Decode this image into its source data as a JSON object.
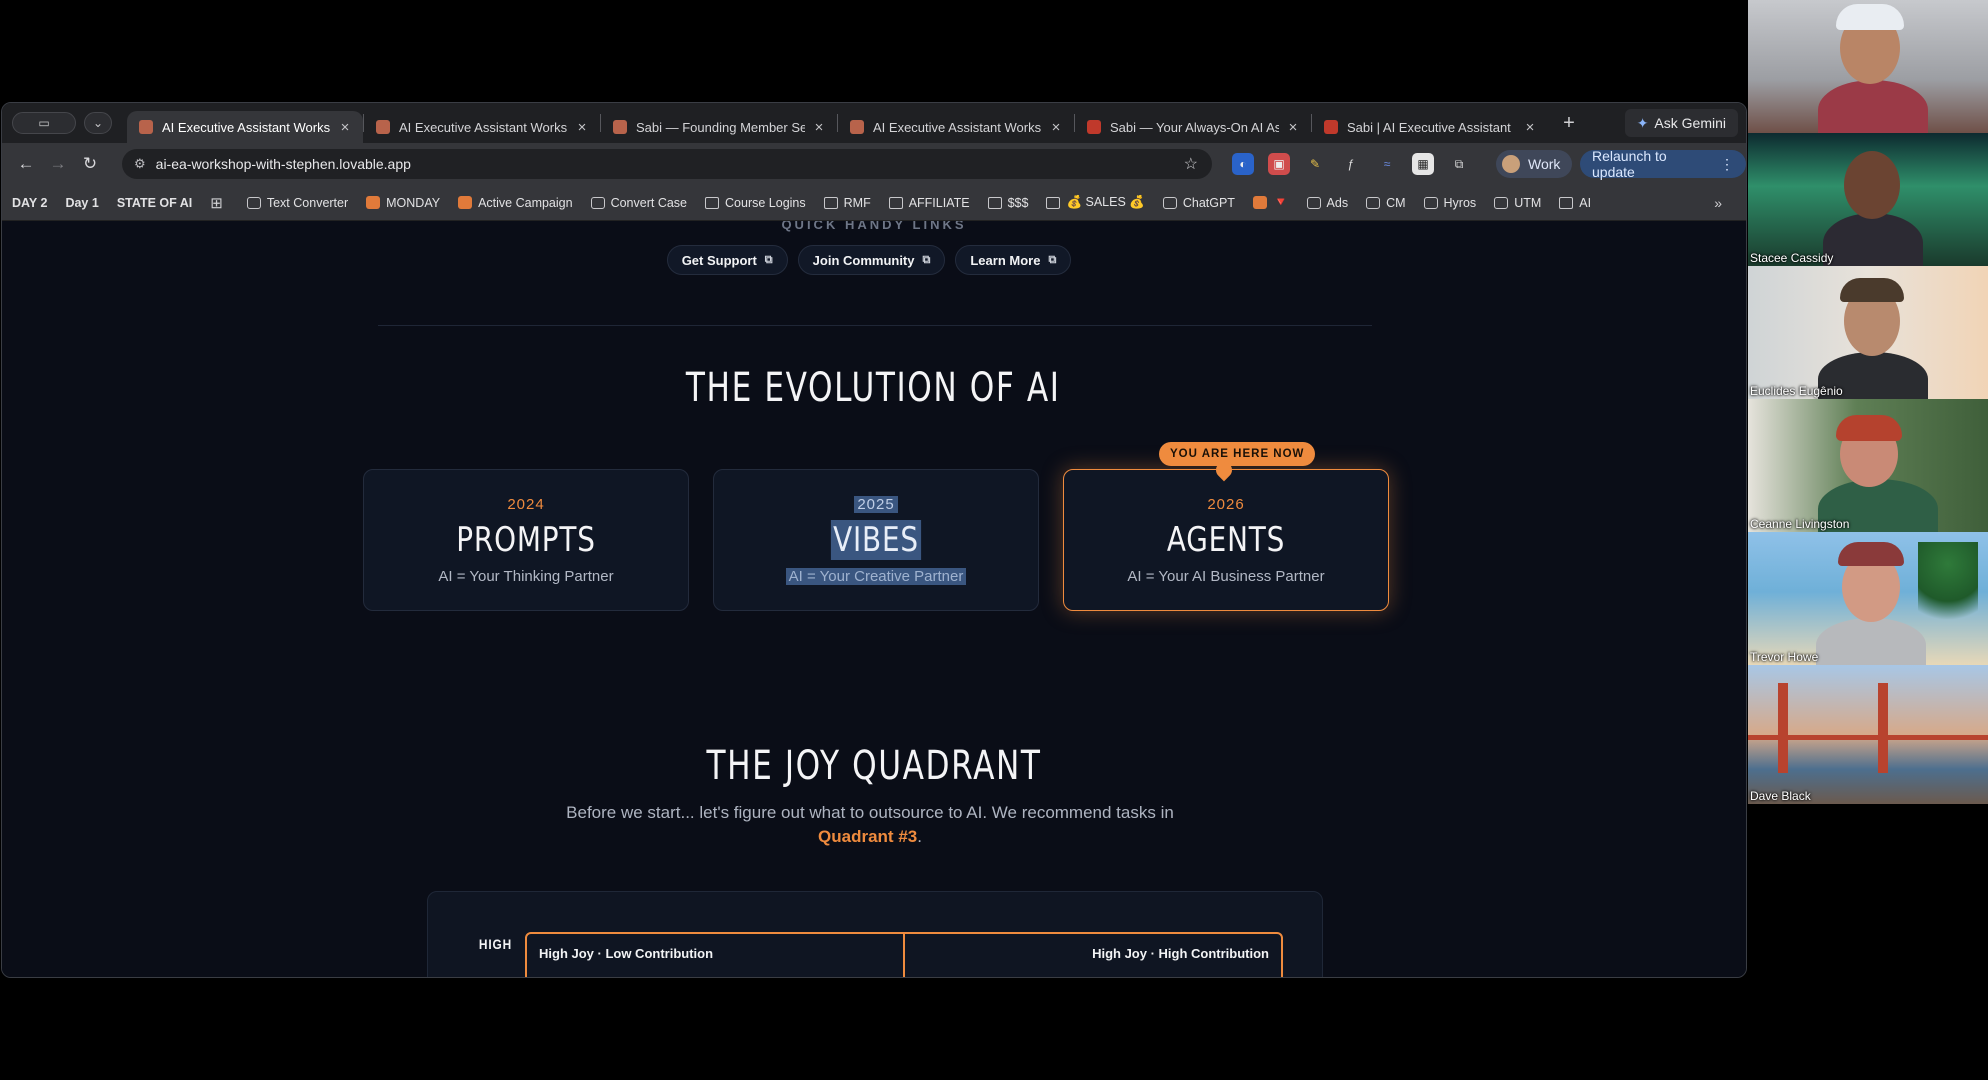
{
  "browser": {
    "tabs": [
      {
        "title": "AI Executive Assistant Works",
        "active": true,
        "fav": "#b8634b"
      },
      {
        "title": "AI Executive Assistant Works",
        "active": false,
        "fav": "#b8634b"
      },
      {
        "title": "Sabi — Founding Member Se",
        "active": false,
        "fav": "#b8634b"
      },
      {
        "title": "AI Executive Assistant Works",
        "active": false,
        "fav": "#b8634b"
      },
      {
        "title": "Sabi — Your Always-On AI As",
        "active": false,
        "fav": "#c0392b"
      },
      {
        "title": "Sabi | AI Executive Assistant",
        "active": false,
        "fav": "#c0392b"
      }
    ],
    "ask_gemini": "Ask Gemini",
    "url": "ai-ea-workshop-with-stephen.lovable.app",
    "profile": "Work",
    "relaunch": "Relaunch to update",
    "bookmarks": [
      {
        "label": "DAY 2",
        "bold": true,
        "icon": "none"
      },
      {
        "label": "Day 1",
        "bold": true,
        "icon": "none"
      },
      {
        "label": "STATE OF AI",
        "bold": true,
        "icon": "none"
      },
      {
        "label": "",
        "bold": false,
        "icon": "apps"
      },
      {
        "label": "Text Converter",
        "bold": false,
        "icon": "page"
      },
      {
        "label": "MONDAY",
        "bold": false,
        "icon": "solid"
      },
      {
        "label": "Active Campaign",
        "bold": false,
        "icon": "solid"
      },
      {
        "label": "Convert Case",
        "bold": false,
        "icon": "page"
      },
      {
        "label": "Course Logins",
        "bold": false,
        "icon": "folder"
      },
      {
        "label": "RMF",
        "bold": false,
        "icon": "folder"
      },
      {
        "label": "AFFILIATE",
        "bold": false,
        "icon": "folder"
      },
      {
        "label": "$$$",
        "bold": false,
        "icon": "folder"
      },
      {
        "label": "💰 SALES 💰",
        "bold": false,
        "icon": "folder"
      },
      {
        "label": "ChatGPT",
        "bold": false,
        "icon": "page"
      },
      {
        "label": "🔻",
        "bold": false,
        "icon": "solid"
      },
      {
        "label": "Ads",
        "bold": false,
        "icon": "page"
      },
      {
        "label": "CM",
        "bold": false,
        "icon": "page"
      },
      {
        "label": "Hyros",
        "bold": false,
        "icon": "page"
      },
      {
        "label": "UTM",
        "bold": false,
        "icon": "page"
      },
      {
        "label": "AI",
        "bold": false,
        "icon": "folder"
      }
    ]
  },
  "page": {
    "quick_links_title": "QUICK HANDY LINKS",
    "quick_links": [
      "Get Support",
      "Join Community",
      "Learn More"
    ],
    "evolution_title": "THE EVOLUTION OF AI",
    "you_are_here": "YOU ARE HERE NOW",
    "cards": [
      {
        "year": "2024",
        "name": "PROMPTS",
        "desc": "AI = Your Thinking Partner"
      },
      {
        "year": "2025",
        "name": "VIBES",
        "desc": "AI = Your Creative Partner"
      },
      {
        "year": "2026",
        "name": "AGENTS",
        "desc": "AI = Your AI Business Partner"
      }
    ],
    "joy_title": "THE JOY QUADRANT",
    "joy_sub_1": "Before we start... let's figure out what to outsource to AI. We recommend tasks in",
    "joy_sub_q3": "Quadrant #3",
    "joy_sub_end": ".",
    "quad_high": "HIGH",
    "quad_tl": "High Joy · Low Contribution",
    "quad_tr": "High Joy · High Contribution"
  },
  "participants": [
    "",
    "Stacee Cassidy",
    "Euclides Eugênio",
    "Ceanne Livingston",
    "Trevor Howe",
    "Dave Black"
  ],
  "colors": {
    "accent": "#ef8b3e",
    "page_bg": "#0a0d17",
    "card_bg": "#0f1624"
  }
}
